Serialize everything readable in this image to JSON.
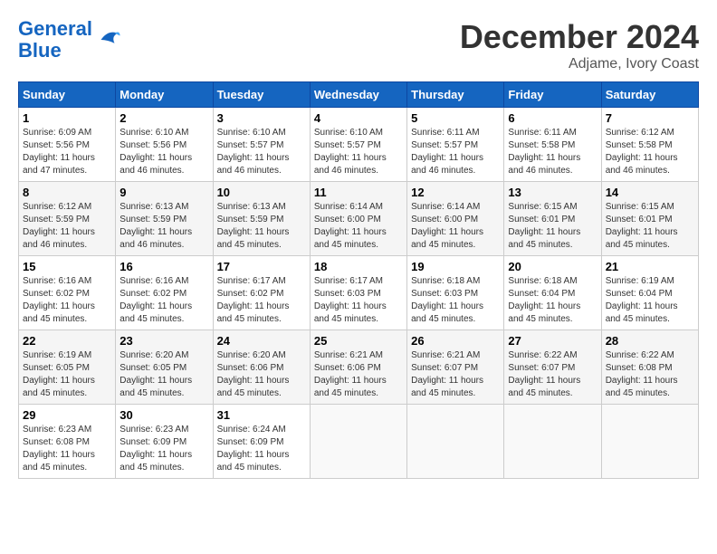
{
  "header": {
    "logo_line1": "General",
    "logo_line2": "Blue",
    "month_title": "December 2024",
    "location": "Adjame, Ivory Coast"
  },
  "weekdays": [
    "Sunday",
    "Monday",
    "Tuesday",
    "Wednesday",
    "Thursday",
    "Friday",
    "Saturday"
  ],
  "weeks": [
    [
      {
        "day": "1",
        "sunrise": "6:09 AM",
        "sunset": "5:56 PM",
        "daylight": "11 hours and 47 minutes."
      },
      {
        "day": "2",
        "sunrise": "6:10 AM",
        "sunset": "5:56 PM",
        "daylight": "11 hours and 46 minutes."
      },
      {
        "day": "3",
        "sunrise": "6:10 AM",
        "sunset": "5:57 PM",
        "daylight": "11 hours and 46 minutes."
      },
      {
        "day": "4",
        "sunrise": "6:10 AM",
        "sunset": "5:57 PM",
        "daylight": "11 hours and 46 minutes."
      },
      {
        "day": "5",
        "sunrise": "6:11 AM",
        "sunset": "5:57 PM",
        "daylight": "11 hours and 46 minutes."
      },
      {
        "day": "6",
        "sunrise": "6:11 AM",
        "sunset": "5:58 PM",
        "daylight": "11 hours and 46 minutes."
      },
      {
        "day": "7",
        "sunrise": "6:12 AM",
        "sunset": "5:58 PM",
        "daylight": "11 hours and 46 minutes."
      }
    ],
    [
      {
        "day": "8",
        "sunrise": "6:12 AM",
        "sunset": "5:59 PM",
        "daylight": "11 hours and 46 minutes."
      },
      {
        "day": "9",
        "sunrise": "6:13 AM",
        "sunset": "5:59 PM",
        "daylight": "11 hours and 46 minutes."
      },
      {
        "day": "10",
        "sunrise": "6:13 AM",
        "sunset": "5:59 PM",
        "daylight": "11 hours and 45 minutes."
      },
      {
        "day": "11",
        "sunrise": "6:14 AM",
        "sunset": "6:00 PM",
        "daylight": "11 hours and 45 minutes."
      },
      {
        "day": "12",
        "sunrise": "6:14 AM",
        "sunset": "6:00 PM",
        "daylight": "11 hours and 45 minutes."
      },
      {
        "day": "13",
        "sunrise": "6:15 AM",
        "sunset": "6:01 PM",
        "daylight": "11 hours and 45 minutes."
      },
      {
        "day": "14",
        "sunrise": "6:15 AM",
        "sunset": "6:01 PM",
        "daylight": "11 hours and 45 minutes."
      }
    ],
    [
      {
        "day": "15",
        "sunrise": "6:16 AM",
        "sunset": "6:02 PM",
        "daylight": "11 hours and 45 minutes."
      },
      {
        "day": "16",
        "sunrise": "6:16 AM",
        "sunset": "6:02 PM",
        "daylight": "11 hours and 45 minutes."
      },
      {
        "day": "17",
        "sunrise": "6:17 AM",
        "sunset": "6:02 PM",
        "daylight": "11 hours and 45 minutes."
      },
      {
        "day": "18",
        "sunrise": "6:17 AM",
        "sunset": "6:03 PM",
        "daylight": "11 hours and 45 minutes."
      },
      {
        "day": "19",
        "sunrise": "6:18 AM",
        "sunset": "6:03 PM",
        "daylight": "11 hours and 45 minutes."
      },
      {
        "day": "20",
        "sunrise": "6:18 AM",
        "sunset": "6:04 PM",
        "daylight": "11 hours and 45 minutes."
      },
      {
        "day": "21",
        "sunrise": "6:19 AM",
        "sunset": "6:04 PM",
        "daylight": "11 hours and 45 minutes."
      }
    ],
    [
      {
        "day": "22",
        "sunrise": "6:19 AM",
        "sunset": "6:05 PM",
        "daylight": "11 hours and 45 minutes."
      },
      {
        "day": "23",
        "sunrise": "6:20 AM",
        "sunset": "6:05 PM",
        "daylight": "11 hours and 45 minutes."
      },
      {
        "day": "24",
        "sunrise": "6:20 AM",
        "sunset": "6:06 PM",
        "daylight": "11 hours and 45 minutes."
      },
      {
        "day": "25",
        "sunrise": "6:21 AM",
        "sunset": "6:06 PM",
        "daylight": "11 hours and 45 minutes."
      },
      {
        "day": "26",
        "sunrise": "6:21 AM",
        "sunset": "6:07 PM",
        "daylight": "11 hours and 45 minutes."
      },
      {
        "day": "27",
        "sunrise": "6:22 AM",
        "sunset": "6:07 PM",
        "daylight": "11 hours and 45 minutes."
      },
      {
        "day": "28",
        "sunrise": "6:22 AM",
        "sunset": "6:08 PM",
        "daylight": "11 hours and 45 minutes."
      }
    ],
    [
      {
        "day": "29",
        "sunrise": "6:23 AM",
        "sunset": "6:08 PM",
        "daylight": "11 hours and 45 minutes."
      },
      {
        "day": "30",
        "sunrise": "6:23 AM",
        "sunset": "6:09 PM",
        "daylight": "11 hours and 45 minutes."
      },
      {
        "day": "31",
        "sunrise": "6:24 AM",
        "sunset": "6:09 PM",
        "daylight": "11 hours and 45 minutes."
      },
      null,
      null,
      null,
      null
    ]
  ]
}
